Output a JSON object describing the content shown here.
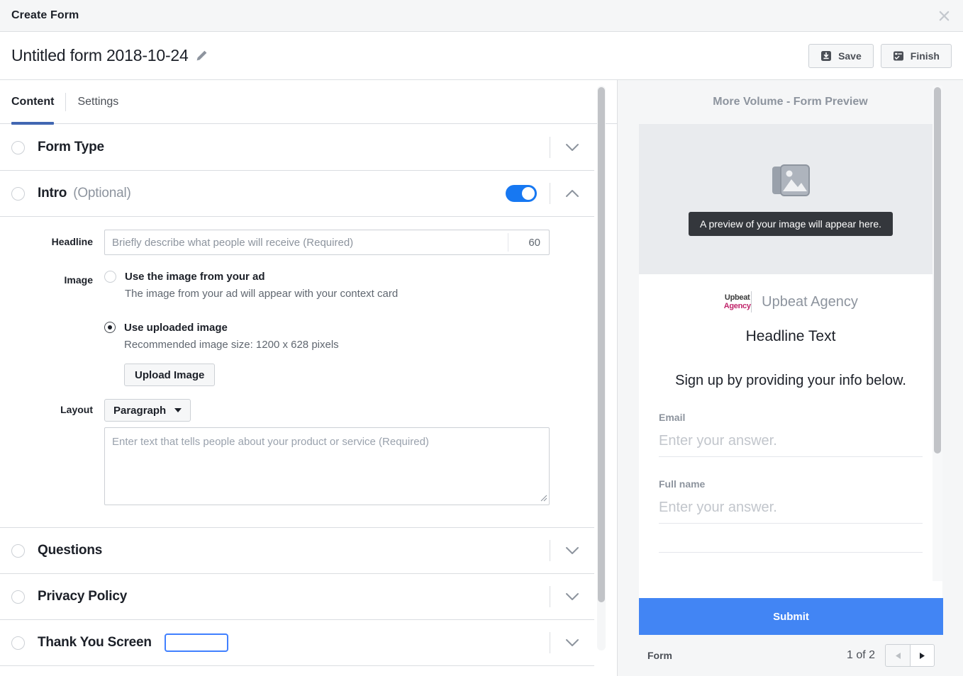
{
  "dialog": {
    "title": "Create Form",
    "close_icon": "close-icon"
  },
  "form_header": {
    "name": "Untitled form 2018-10-24",
    "edit_icon": "pencil-icon",
    "save_label": "Save",
    "save_icon": "save-disk-icon",
    "finish_label": "Finish",
    "finish_icon": "form-check-icon"
  },
  "tabs": [
    {
      "label": "Content",
      "active": true
    },
    {
      "label": "Settings",
      "active": false
    }
  ],
  "sections": [
    {
      "title": "Form Type",
      "optional": "",
      "expanded": false,
      "chevron": "chevron-down-icon"
    },
    {
      "title": "Intro",
      "optional": "(Optional)",
      "expanded": true,
      "chevron": "chevron-up-icon",
      "toggle_on": true
    },
    {
      "title": "Questions",
      "optional": "",
      "expanded": false,
      "chevron": "chevron-down-icon"
    },
    {
      "title": "Privacy Policy",
      "optional": "",
      "expanded": false,
      "chevron": "chevron-down-icon"
    },
    {
      "title": "Thank You Screen",
      "optional": "",
      "expanded": false,
      "chevron": "chevron-down-icon"
    }
  ],
  "intro": {
    "headline_label": "Headline",
    "headline_value": "",
    "headline_placeholder": "Briefly describe what people will receive (Required)",
    "headline_counter": "60",
    "image_label": "Image",
    "option_ad": {
      "title": "Use the image from your ad",
      "subtitle": "The image from your ad will appear with your context card",
      "selected": false
    },
    "option_upload": {
      "title": "Use uploaded image",
      "subtitle": "Recommended image size: 1200 x 628 pixels",
      "selected": true
    },
    "upload_button": "Upload Image",
    "layout_label": "Layout",
    "layout_value": "Paragraph",
    "body_value": "",
    "body_placeholder": "Enter text that tells people about your product or service (Required)"
  },
  "preview": {
    "title": "More Volume - Form Preview",
    "image_icon": "photos-stack-icon",
    "image_tooltip": "A preview of your image will appear here.",
    "logo_line1": "Upbeat",
    "logo_line2": "Agency",
    "brand_name": "Upbeat Agency",
    "headline": "Headline Text",
    "description": "Sign up by providing your info below.",
    "questions": [
      {
        "label": "Email",
        "placeholder": "Enter your answer."
      },
      {
        "label": "Full name",
        "placeholder": "Enter your answer."
      }
    ],
    "submit_label": "Submit",
    "footer_label": "Form",
    "footer_count": "1 of 2",
    "prev_icon": "triangle-left-icon",
    "next_icon": "triangle-right-icon"
  },
  "colors": {
    "accent_blue": "#1778f2",
    "tab_underline": "#4267b2",
    "submit_blue": "#4285f4",
    "logo_magenta": "#c0256b",
    "tooltip_bg": "#34373c"
  }
}
